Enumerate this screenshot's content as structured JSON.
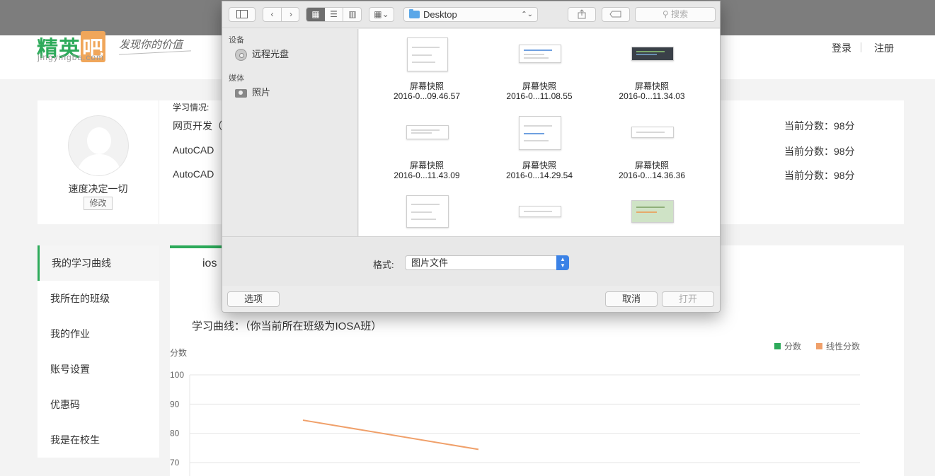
{
  "header": {
    "logo_text": "精英吧",
    "logo_url_text": "jingyingba.com",
    "slogan": "发现你的价值",
    "login": "登录",
    "register": "注册"
  },
  "profile": {
    "username": "速度决定一切",
    "edit_label": "修改",
    "study_label": "学习情况:",
    "courses": [
      {
        "name": "网页开发（",
        "score": "当前分数：98分"
      },
      {
        "name": "AutoCAD",
        "score": "当前分数：98分"
      },
      {
        "name": "AutoCAD",
        "score": "当前分数：98分"
      }
    ]
  },
  "sidenav": {
    "items": [
      {
        "label": "我的学习曲线",
        "active": true
      },
      {
        "label": "我所在的班级",
        "active": false
      },
      {
        "label": "我的作业",
        "active": false
      },
      {
        "label": "账号设置",
        "active": false
      },
      {
        "label": "优惠码",
        "active": false
      },
      {
        "label": "我是在校生",
        "active": false
      }
    ]
  },
  "main": {
    "tab_label": "ios",
    "curve_title": "学习曲线：（你当前所在班级为IOSA班）"
  },
  "chart_data": {
    "type": "line",
    "title": "",
    "ylabel": "分数",
    "xlabel": "",
    "ylim": [
      70,
      100
    ],
    "yticks": [
      100,
      90,
      80,
      70
    ],
    "grid": true,
    "legend_position": "top-right",
    "series": [
      {
        "name": "分数",
        "color": "#2daa5a",
        "points": []
      },
      {
        "name": "线性分数",
        "color": "#f0a06a",
        "points": [
          [
            0,
            84.5
          ],
          [
            1,
            74.5
          ]
        ]
      }
    ]
  },
  "dialog": {
    "location": "Desktop",
    "search_placeholder": "搜索",
    "sidebar": {
      "devices_header": "设备",
      "devices": [
        {
          "label": "远程光盘",
          "icon": "disc-icon"
        }
      ],
      "media_header": "媒体",
      "media": [
        {
          "label": "照片",
          "icon": "camera-icon"
        }
      ]
    },
    "files": [
      {
        "name": "屏幕快照",
        "date": "2016-0...09.46.57"
      },
      {
        "name": "屏幕快照",
        "date": "2016-0...11.08.55"
      },
      {
        "name": "屏幕快照",
        "date": "2016-0...11.34.03"
      },
      {
        "name": "屏幕快照",
        "date": "2016-0...11.43.09"
      },
      {
        "name": "屏幕快照",
        "date": "2016-0...14.29.54"
      },
      {
        "name": "屏幕快照",
        "date": "2016-0...14.36.36"
      },
      {
        "name": "",
        "date": ""
      },
      {
        "name": "",
        "date": ""
      },
      {
        "name": "",
        "date": ""
      }
    ],
    "format_label": "格式:",
    "format_value": "图片文件",
    "options_button": "选项",
    "cancel_button": "取消",
    "open_button": "打开",
    "accent": "#3b82e6"
  }
}
